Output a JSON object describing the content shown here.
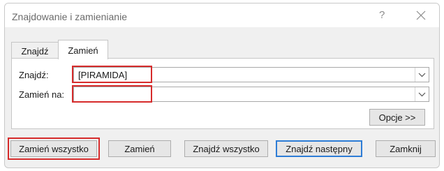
{
  "title": "Znajdowanie i zamienianie",
  "titlebar": {
    "help": "?",
    "close_icon": "close-icon"
  },
  "tabs": [
    {
      "label": "Znajdź",
      "active": false
    },
    {
      "label": "Zamień",
      "active": true
    }
  ],
  "find": {
    "label": "Znajdź:",
    "value": "[PIRAMIDA]"
  },
  "replace": {
    "label": "Zamień na:",
    "value": ""
  },
  "options_button": "Opcje >>",
  "buttons": {
    "replace_all": "Zamień wszystko",
    "replace": "Zamień",
    "find_all": "Znajdź wszystko",
    "find_next": "Znajdź następny",
    "close": "Zamknij"
  },
  "highlight_color": "#d62b2b",
  "focus_color": "#2e7dd6"
}
